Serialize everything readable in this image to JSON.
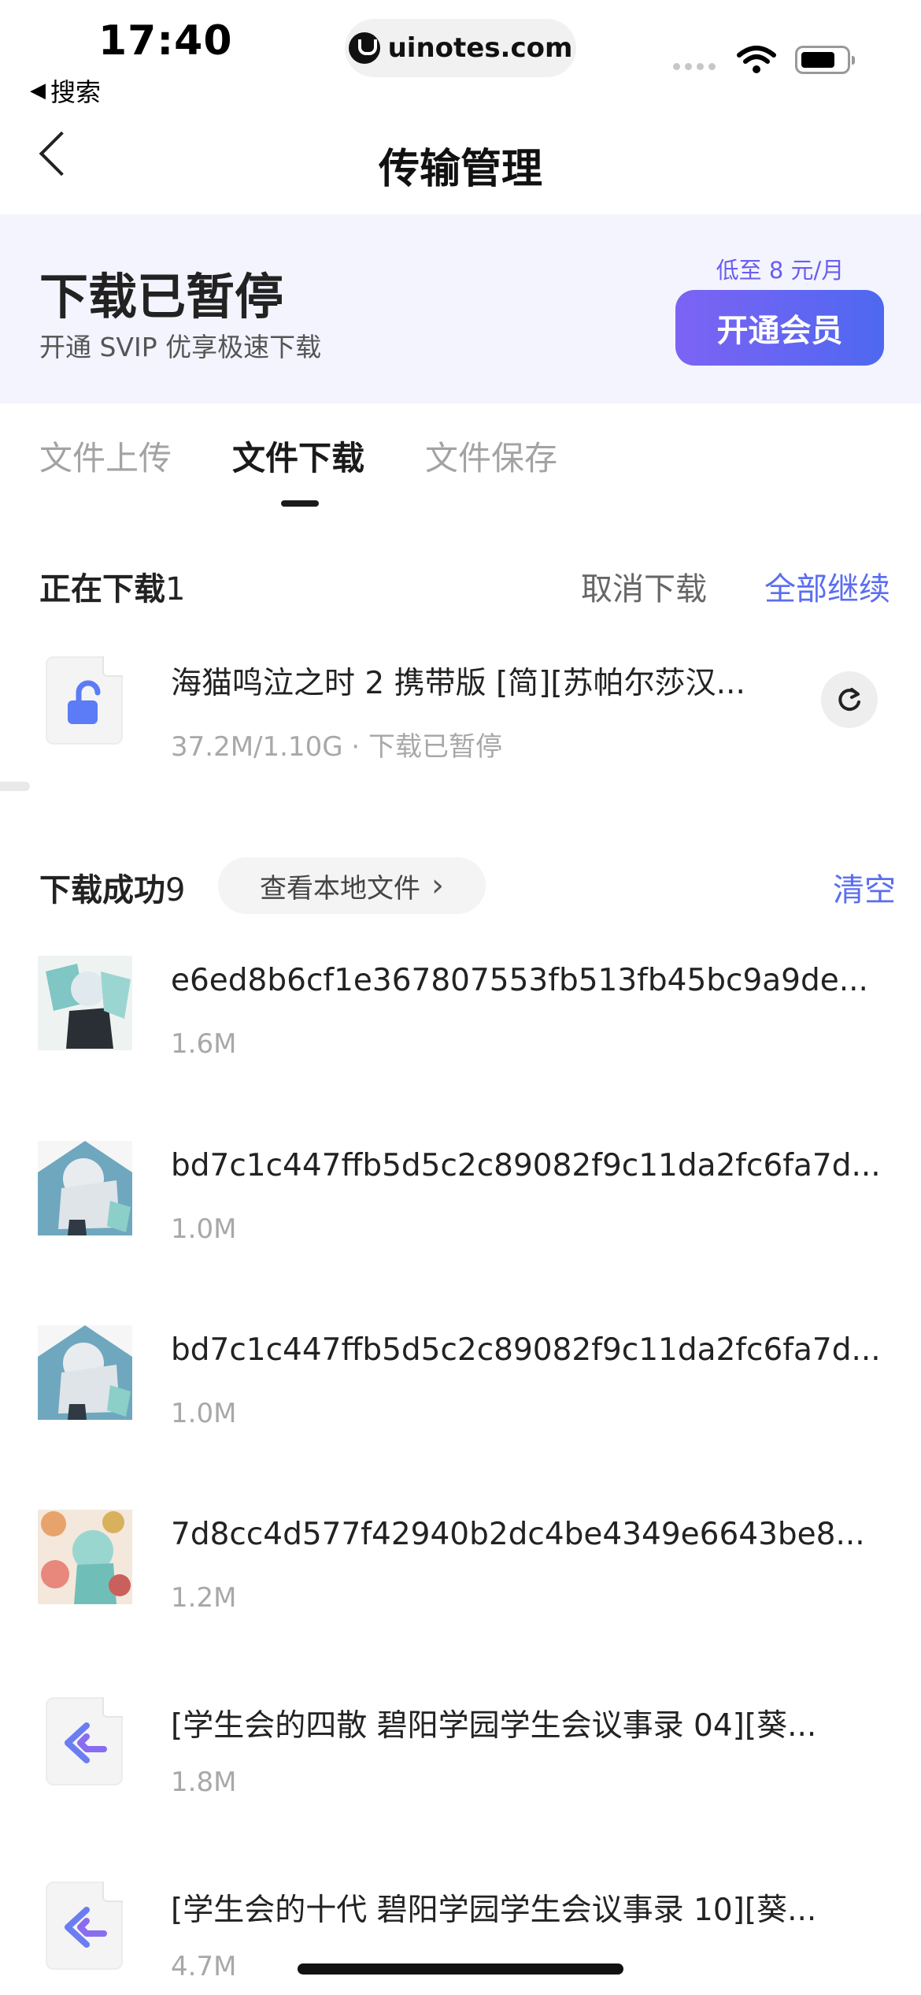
{
  "status_bar": {
    "time": "17:40",
    "back_label": "搜索",
    "url": "uinotes.com"
  },
  "nav": {
    "title": "传输管理"
  },
  "banner": {
    "title": "下载已暂停",
    "subtitle": "开通 SVIP 优享极速下载",
    "price": "低至 8 元/月",
    "button": "开通会员",
    "accent": "#6a5df0"
  },
  "tabs": [
    {
      "label": "文件上传",
      "active": false
    },
    {
      "label": "文件下载",
      "active": true
    },
    {
      "label": "文件保存",
      "active": false
    }
  ],
  "downloading": {
    "title": "正在下载",
    "count": "1",
    "cancel": "取消下载",
    "resume_all": "全部继续",
    "items": [
      {
        "name": "海猫鸣泣之时 2 携带版 [简][苏帕尔莎汉...",
        "size": "37.2M/1.10G",
        "status": "下载已暂停",
        "icon": "zip-file-icon"
      }
    ]
  },
  "completed": {
    "title": "下载成功",
    "count": "9",
    "view_local": "查看本地文件",
    "clear": "清空",
    "items": [
      {
        "name": "e6ed8b6cf1e367807553fb513fb45bc9a9de...",
        "size": "1.6M",
        "icon": "image-thumbnail"
      },
      {
        "name": "bd7c1c447ffb5d5c2c89082f9c11da2fc6fa7d...",
        "size": "1.0M",
        "icon": "image-thumbnail"
      },
      {
        "name": "bd7c1c447ffb5d5c2c89082f9c11da2fc6fa7d...",
        "size": "1.0M",
        "icon": "image-thumbnail"
      },
      {
        "name": "7d8cc4d577f42940b2dc4be4349e6643be8...",
        "size": "1.2M",
        "icon": "image-thumbnail"
      },
      {
        "name": "[学生会的四散 碧阳学园学生会议事录 04][葵...",
        "size": "1.8M",
        "icon": "ebook-file-icon"
      },
      {
        "name": "[学生会的十代 碧阳学园学生会议事录 10][葵...",
        "size": "4.7M",
        "icon": "ebook-file-icon"
      }
    ]
  },
  "colors": {
    "link": "#5b6ef0",
    "muted": "#a8a8a8"
  }
}
